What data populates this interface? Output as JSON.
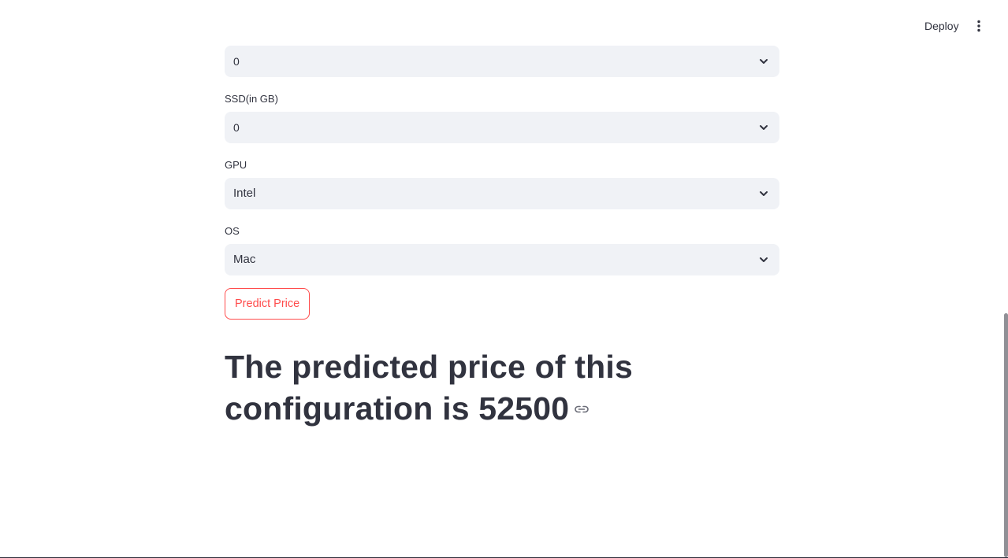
{
  "header": {
    "deploy_label": "Deploy",
    "menu_icon": "vertical-ellipsis-icon"
  },
  "form": {
    "ram_select": {
      "value": "0"
    },
    "ssd": {
      "label": "SSD(in GB)",
      "value": "0"
    },
    "gpu": {
      "label": "GPU",
      "value": "Intel"
    },
    "os": {
      "label": "OS",
      "value": "Mac"
    },
    "predict_button_label": "Predict Price"
  },
  "result": {
    "heading": "The predicted price of this configuration is 52500",
    "anchor_icon": "link-icon"
  },
  "colors": {
    "accent": "#ff4b4b",
    "text": "#31333f",
    "input_background": "#f0f2f6"
  }
}
